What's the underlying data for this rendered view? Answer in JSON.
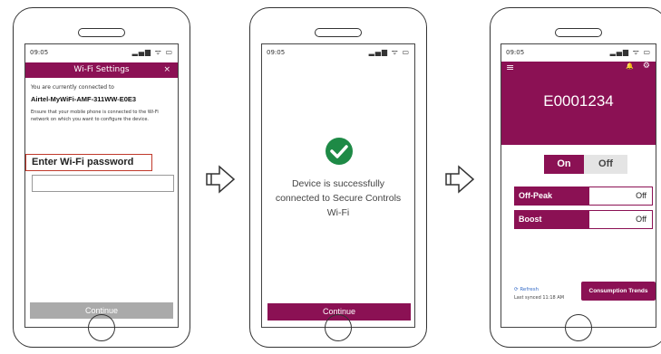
{
  "screen1": {
    "time": "09:05",
    "status_icons": "▂▄▆ ᯤ ▭",
    "title": "Wi-Fi Settings",
    "close": "×",
    "connected_label": "You are currently connected to",
    "network": "Airtel-MyWiFi-AMF-311WW-E0E3",
    "instructions": "Ensure that your mobile phone is connected to the Wi-Fi network on which you want to configure the device.",
    "password_label": "Enter Wi-Fi password",
    "password_value": "",
    "continue": "Continue"
  },
  "screen2": {
    "time": "09:05",
    "status_icons": "▂▄▆ ᯤ ▭",
    "message": "Device is successfully connected to Secure Controls Wi-Fi",
    "continue": "Continue"
  },
  "screen3": {
    "time": "09:05",
    "status_icons": "▂▄▆ ᯤ ▭",
    "menu_icon": "≡",
    "bell_icon": "🔔",
    "settings_icon": "⚙",
    "device_id": "E0001234",
    "on": "On",
    "off": "Off",
    "rows": [
      {
        "label": "Off-Peak",
        "value": "Off"
      },
      {
        "label": "Boost",
        "value": "Off"
      }
    ],
    "refresh": "Refresh",
    "last_synced": "Last synced 11:18 AM",
    "trends_button": "Consumption Trends"
  },
  "colors": {
    "accent": "#8b1154",
    "disabled": "#aaaaaa",
    "highlight": "#c0392b",
    "success": "#1e8a46"
  }
}
